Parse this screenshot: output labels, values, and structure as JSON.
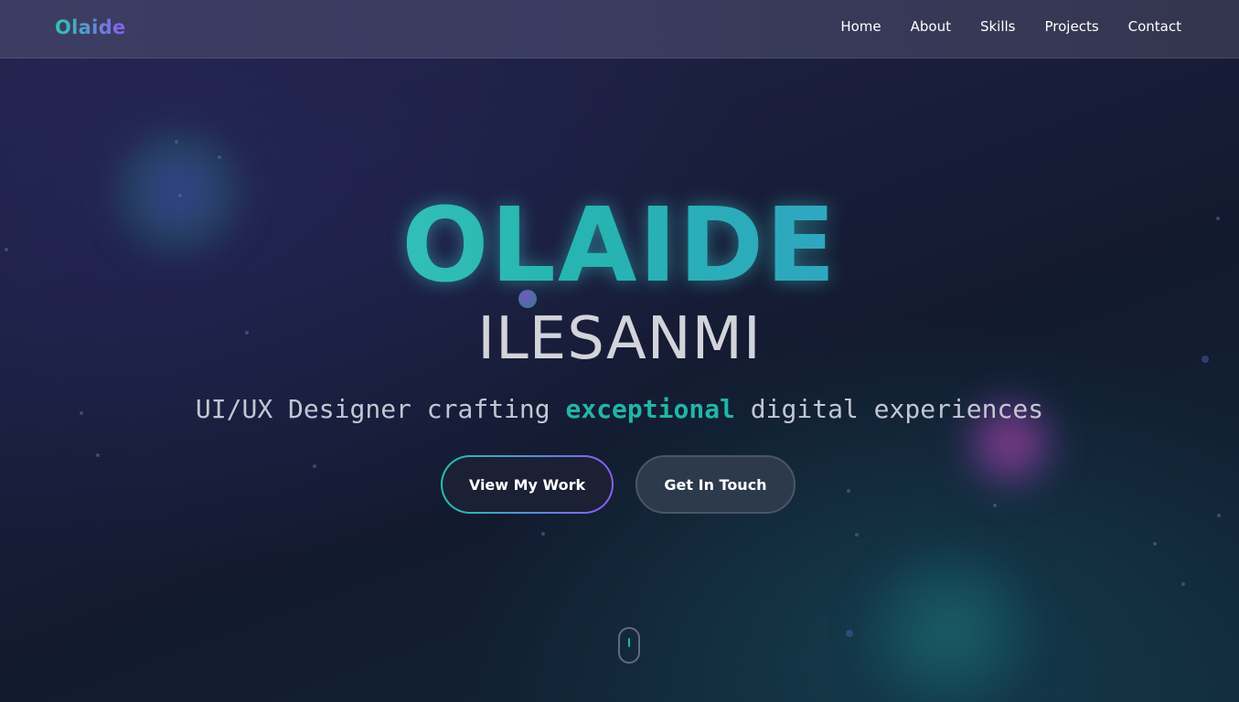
{
  "nav": {
    "brand": "Olaide",
    "links": [
      "Home",
      "About",
      "Skills",
      "Projects",
      "Contact"
    ]
  },
  "hero": {
    "first_name": "OLAIDE",
    "last_name": "ILESANMI",
    "tagline_pre": "UI/UX Designer crafting ",
    "tagline_highlight": "exceptional",
    "tagline_post": " digital experiences",
    "primary_button": "View My Work",
    "secondary_button": "Get In Touch"
  },
  "scroll_progress": 0.2,
  "colors": {
    "accent_teal": "#22b5a5",
    "accent_purple": "#8b5cf6",
    "nav_bg": "#3c3c60"
  },
  "icons": {
    "scroll_indicator": "mouse-scroll-icon"
  }
}
